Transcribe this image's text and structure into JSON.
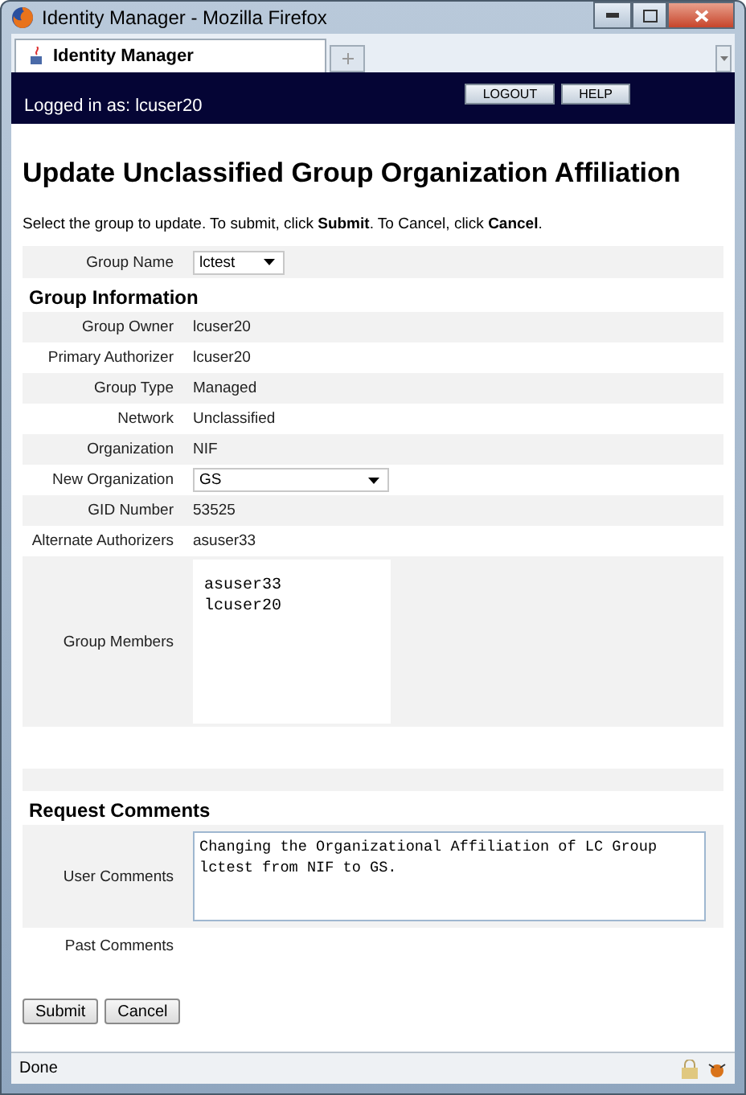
{
  "window": {
    "title": "Identity Manager - Mozilla Firefox"
  },
  "tabs": [
    {
      "label": "Identity Manager",
      "selected": true
    }
  ],
  "header": {
    "logged_in": "Logged in as: lcuser20",
    "buttons": [
      "LOGOUT",
      "HELP"
    ]
  },
  "page": {
    "title": "Update Unclassified Group Organization Affiliation",
    "instructions": "Select the group to update. To submit, click **Submit**. To Cancel, click **Cancel**.",
    "group_name": {
      "label": "Group Name",
      "value": "lctest"
    },
    "group_info": {
      "title": "Group Information",
      "rows": [
        {
          "kind": "text",
          "label": "Group Owner",
          "value": "lcuser20"
        },
        {
          "kind": "text",
          "label": "Primary Authorizer",
          "value": "lcuser20"
        },
        {
          "kind": "text",
          "label": "Group Type",
          "value": "Managed"
        },
        {
          "kind": "text",
          "label": "Network",
          "value": "Unclassified"
        },
        {
          "kind": "text",
          "label": "Organization",
          "value": "NIF"
        },
        {
          "kind": "select",
          "label": "New Organization",
          "value": "GS"
        },
        {
          "kind": "text",
          "label": "GID Number",
          "value": "53525"
        },
        {
          "kind": "text",
          "label": "Alternate Authorizers",
          "value": "asuser33"
        },
        {
          "kind": "list",
          "label": "Group Members",
          "items": [
            "asuser33",
            "lcuser20"
          ]
        }
      ]
    },
    "request_comments": {
      "title": "Request Comments",
      "rows": [
        {
          "kind": "textarea",
          "label": "User Comments",
          "value": "Changing the Organizational Affiliation of LC Group lctest from NIF to GS."
        },
        {
          "kind": "empty",
          "label": "Past Comments"
        }
      ]
    },
    "buttons": [
      "Submit",
      "Cancel"
    ]
  },
  "status_bar": {
    "text": "Done"
  }
}
